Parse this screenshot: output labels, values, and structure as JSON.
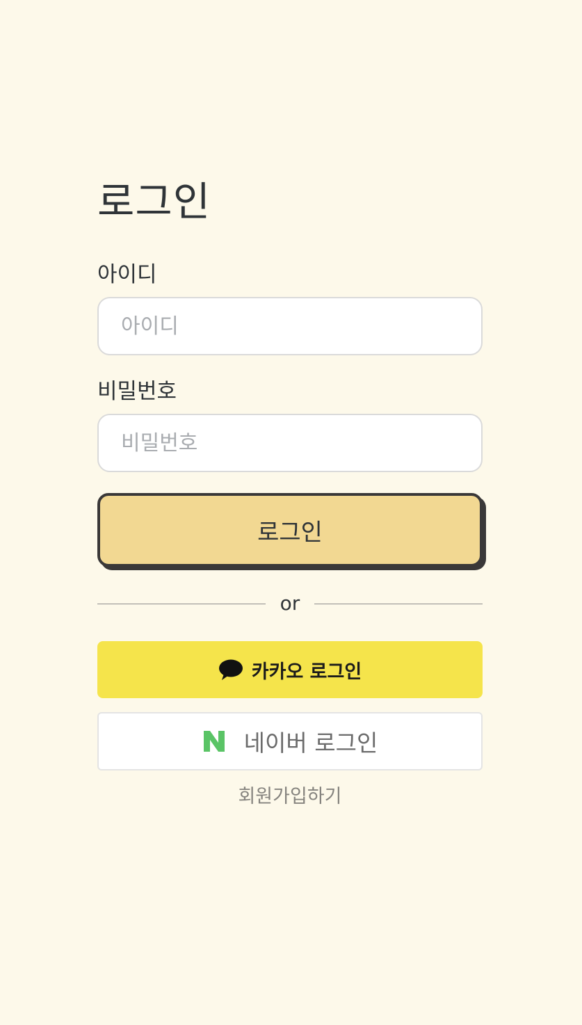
{
  "page": {
    "title": "로그인"
  },
  "form": {
    "id_label": "아이디",
    "id_placeholder": "아이디",
    "id_value": "",
    "password_label": "비밀번호",
    "password_placeholder": "비밀번호",
    "password_value": "",
    "submit_label": "로그인"
  },
  "divider": {
    "text": "or"
  },
  "social": {
    "kakao": {
      "label": "카카오 로그인",
      "icon": "speech-bubble-icon",
      "color": "#f5e44b"
    },
    "naver": {
      "label": "네이버 로그인",
      "icon": "naver-n-icon",
      "color": "#5ac466"
    }
  },
  "signup": {
    "label": "회원가입하기"
  },
  "colors": {
    "background": "#fdf9ea",
    "primary_button": "#f2d892",
    "button_border": "#3a3838",
    "text": "#2f3438"
  }
}
